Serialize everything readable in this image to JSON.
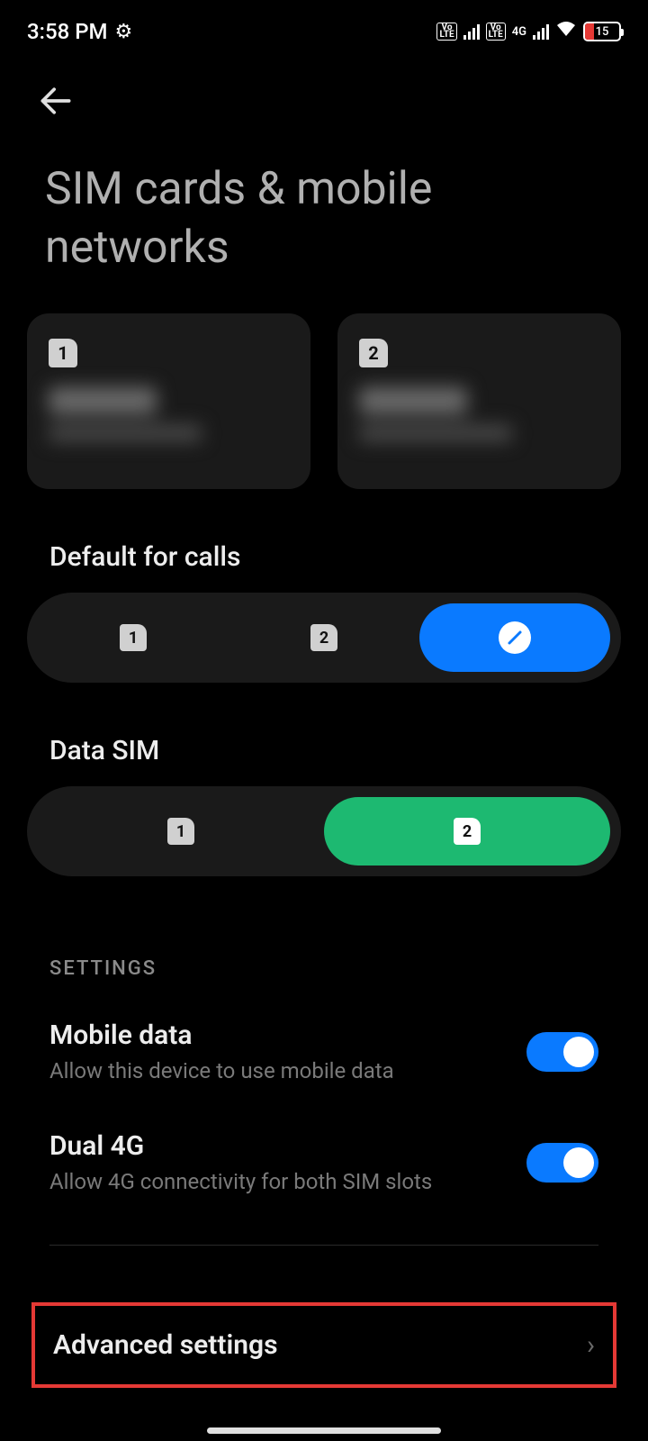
{
  "status": {
    "time": "3:58 PM",
    "battery_pct": "15",
    "volte1": "Vo\nLTE",
    "volte2": "Vo\nLTE",
    "net": "4G"
  },
  "page": {
    "title": "SIM cards & mobile networks"
  },
  "sims": {
    "card1_num": "1",
    "card2_num": "2"
  },
  "default_calls": {
    "label": "Default for calls",
    "opt1": "1",
    "opt2": "2"
  },
  "data_sim": {
    "label": "Data SIM",
    "opt1": "1",
    "opt2": "2"
  },
  "settings": {
    "header": "SETTINGS",
    "mobile_data": {
      "title": "Mobile data",
      "desc": "Allow this device to use mobile data"
    },
    "dual_4g": {
      "title": "Dual 4G",
      "desc": "Allow 4G connectivity for both SIM slots"
    },
    "advanced": {
      "title": "Advanced settings"
    }
  }
}
